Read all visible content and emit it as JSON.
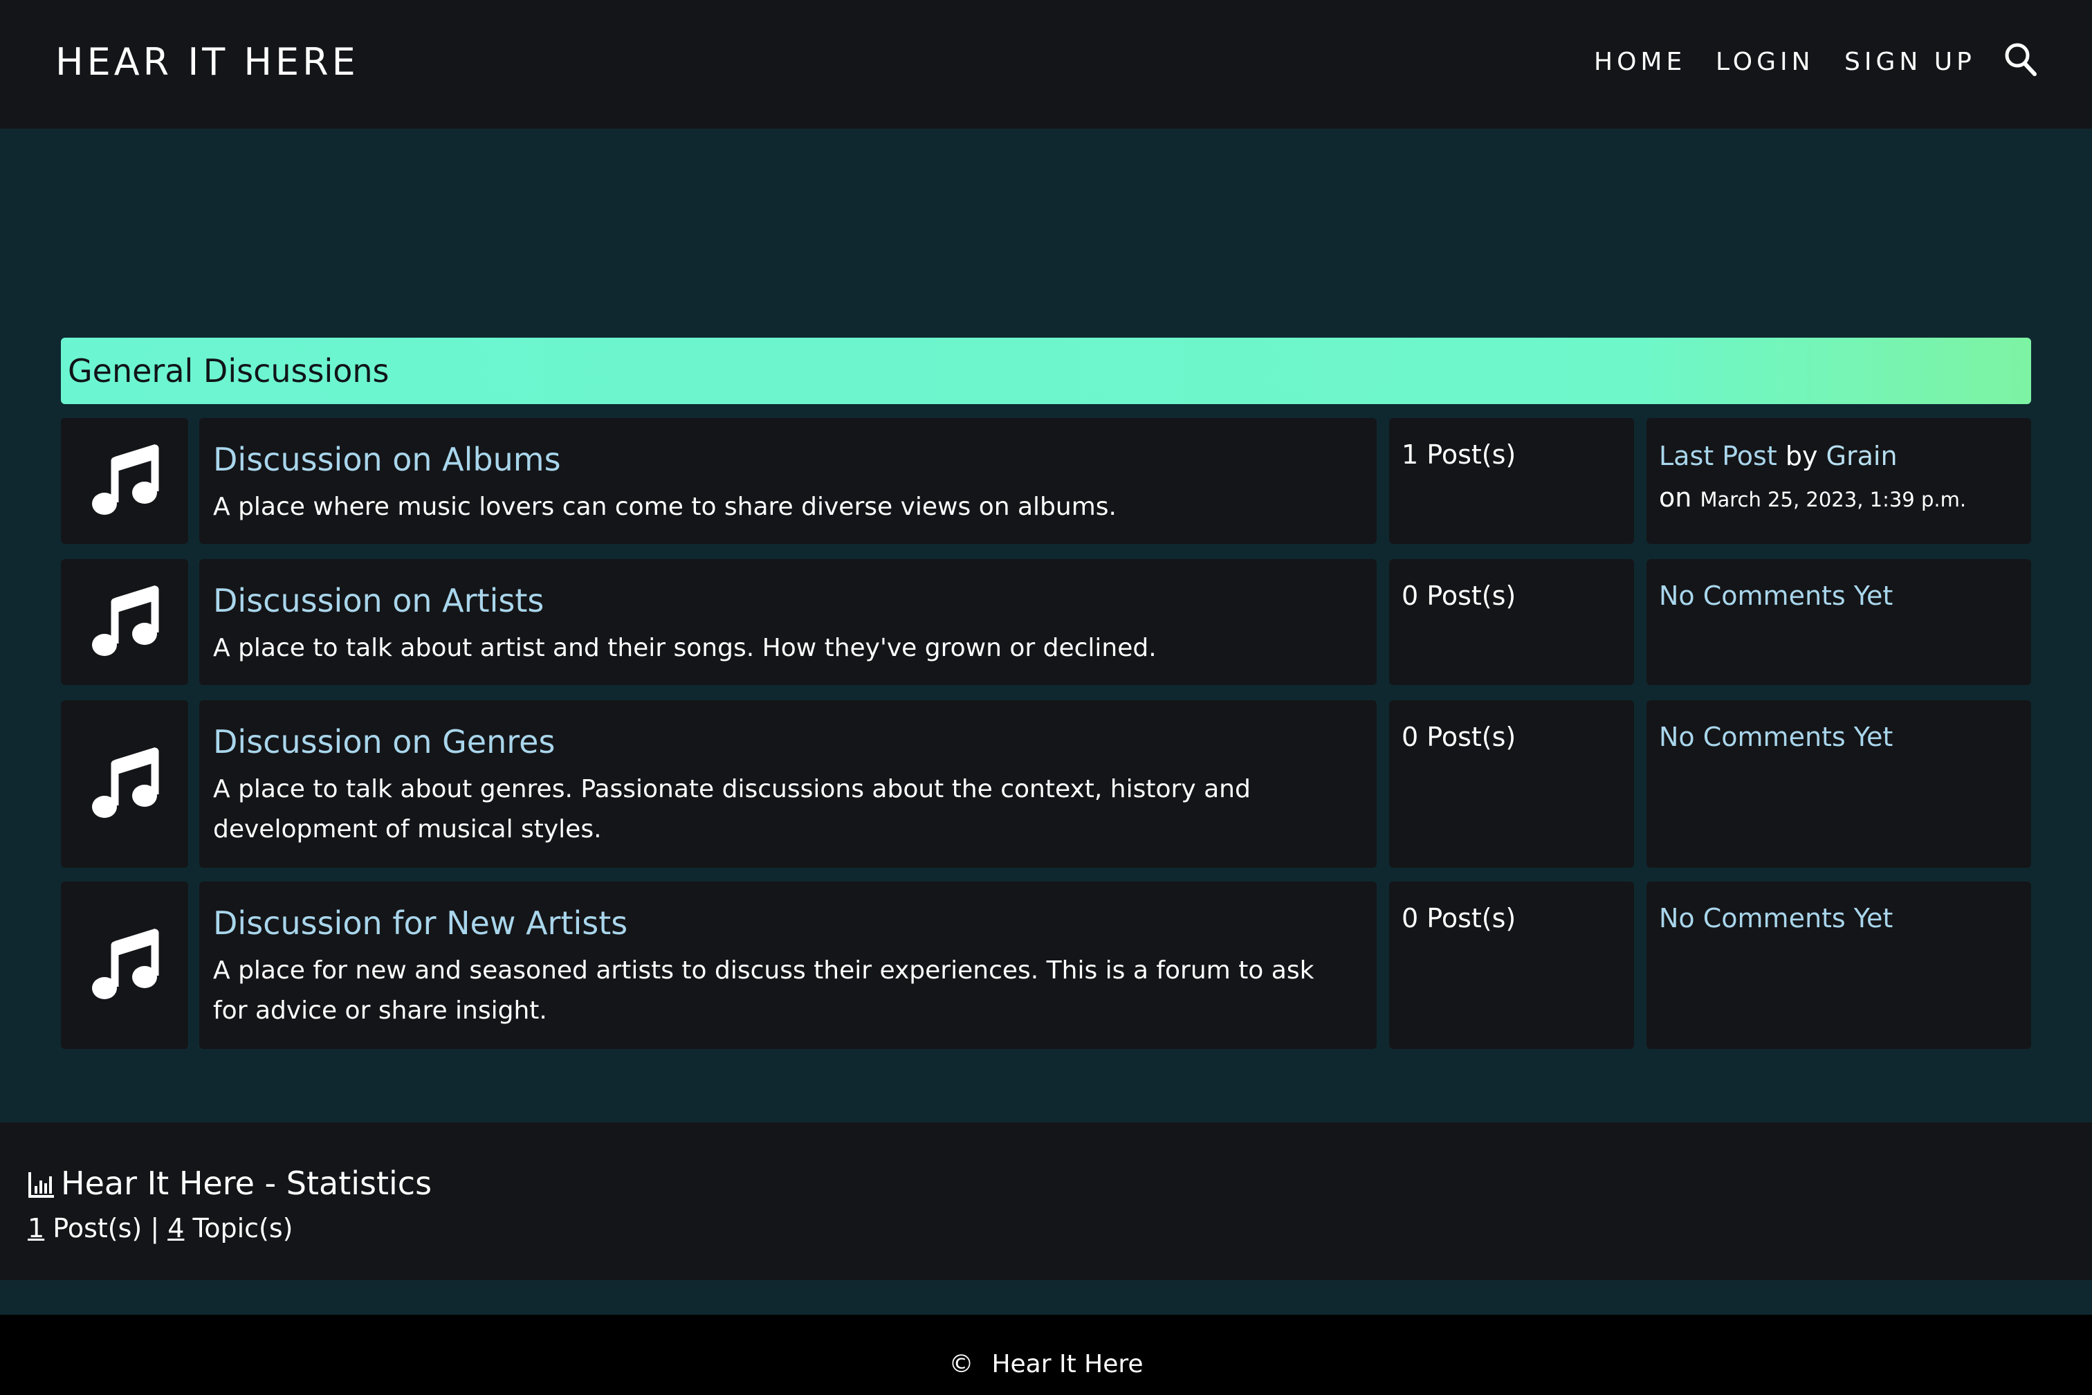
{
  "header": {
    "brand": "HEAR IT HERE",
    "nav": {
      "home": "HOME",
      "login": "LOGIN",
      "signup": "SIGN UP"
    },
    "search_icon": "search-icon"
  },
  "category": {
    "title": "General Discussions"
  },
  "forums": [
    {
      "icon": "music-note-icon",
      "title": "Discussion on Albums",
      "description": "A place where music lovers can come to share diverse views on albums.",
      "posts": "1 Post(s)",
      "last_post": {
        "label": "Last Post",
        "by": "by",
        "author": "Grain",
        "on": "on",
        "date": "March 25, 2023, 1:39 p.m."
      }
    },
    {
      "icon": "music-note-icon",
      "title": "Discussion on Artists",
      "description": "A place to talk about artist and their songs. How they've grown or declined.",
      "posts": "0 Post(s)",
      "last_post_text": "No Comments Yet"
    },
    {
      "icon": "music-note-icon",
      "title": "Discussion on Genres",
      "description": "A place to talk about genres. Passionate discussions about the context, history and development of musical styles.",
      "posts": "0 Post(s)",
      "last_post_text": "No Comments Yet"
    },
    {
      "icon": "music-note-icon",
      "title": "Discussion for New Artists",
      "description": "A place for new and seasoned artists to discuss their experiences. This is a forum to ask for advice or share insight.",
      "posts": "0 Post(s)",
      "last_post_text": "No Comments Yet"
    }
  ],
  "stats": {
    "icon": "bar-chart-icon",
    "title": "Hear It Here - Statistics",
    "post_count": "1",
    "post_label": " Post(s)",
    "separator": " | ",
    "topic_count": "4",
    "topic_label": " Topic(s)"
  },
  "footer": {
    "copyright_symbol": "©",
    "text": "Hear It Here"
  },
  "colors": {
    "page_background": "#0f2830",
    "panel_background": "#141518",
    "accent_gradient_start": "#6cf5d1",
    "accent_gradient_end": "#7df3a3",
    "link_color": "#a9d6ec"
  }
}
